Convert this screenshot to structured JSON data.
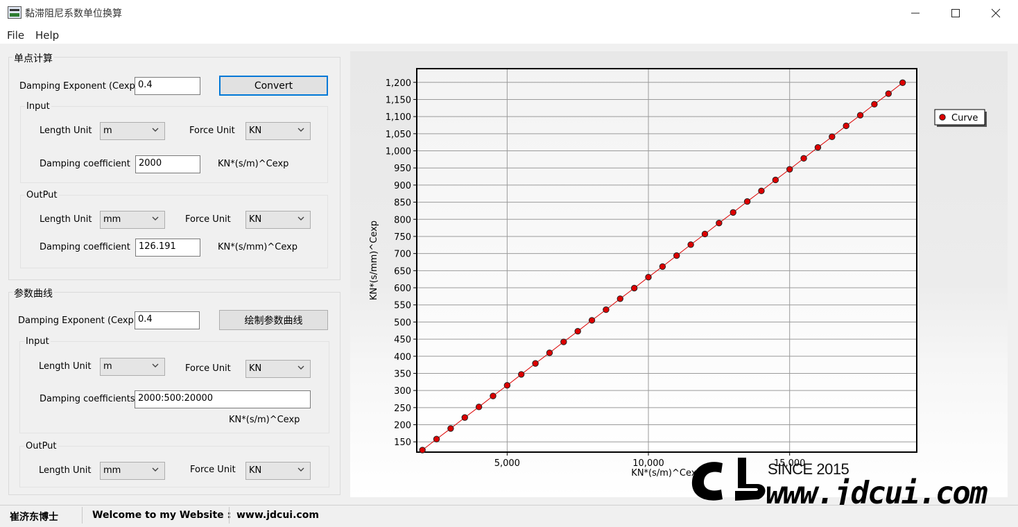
{
  "window": {
    "title": "黏滞阻尼系数单位换算"
  },
  "menu": [
    "File",
    "Help"
  ],
  "single_point": {
    "title": "单点计算",
    "exponent_label": "Damping Exponent (Cexp)",
    "exponent_value": "0.4",
    "convert_label": "Convert",
    "input": {
      "title": "Input",
      "length_label": "Length Unit",
      "length_value": "m",
      "force_label": "Force Unit",
      "force_value": "KN",
      "coef_label": "Damping coefficient",
      "coef_value": "2000",
      "unit_text": "KN*(s/m)^Cexp"
    },
    "output": {
      "title": "OutPut",
      "length_label": "Length Unit",
      "length_value": "mm",
      "force_label": "Force Unit",
      "force_value": "KN",
      "coef_label": "Damping coefficient",
      "coef_value": "126.191",
      "unit_text": "KN*(s/mm)^Cexp"
    }
  },
  "curve": {
    "title": "参数曲线",
    "exponent_label": "Damping Exponent  (Cexp)",
    "exponent_value": "0.4",
    "draw_label": "绘制参数曲线",
    "input": {
      "title": "Input",
      "length_label": "Length Unit",
      "length_value": "m",
      "force_label": "Force Unit",
      "force_value": "KN",
      "coef_label": "Damping coefficients",
      "coef_value": "2000:500:20000",
      "unit_text": "KN*(s/m)^Cexp"
    },
    "output": {
      "title": "OutPut",
      "length_label": "Length Unit",
      "length_value": "mm",
      "force_label": "Force Unit",
      "force_value": "KN"
    }
  },
  "chart_data": {
    "type": "line",
    "title": "",
    "xlabel": "KN*(s/m)^Cexp",
    "ylabel": "KN*(s/mm)^Cexp",
    "xlim": [
      1800,
      19500
    ],
    "ylim": [
      120,
      1240
    ],
    "x_ticks": [
      5000,
      10000,
      15000
    ],
    "x_tick_labels": [
      "5,000",
      "10,000",
      "15,000"
    ],
    "y_ticks": [
      150,
      200,
      250,
      300,
      350,
      400,
      450,
      500,
      550,
      600,
      650,
      700,
      750,
      800,
      850,
      900,
      950,
      1000,
      1050,
      1100,
      1150,
      1200
    ],
    "y_tick_labels": [
      "150",
      "200",
      "250",
      "300",
      "350",
      "400",
      "450",
      "500",
      "550",
      "600",
      "650",
      "700",
      "750",
      "800",
      "850",
      "900",
      "950",
      "1,000",
      "1,050",
      "1,100",
      "1,150",
      "1,200"
    ],
    "grid": true,
    "legend": "right",
    "series": [
      {
        "name": "Curve",
        "color": "#dd0000",
        "x": [
          2000,
          2500,
          3000,
          3500,
          4000,
          4500,
          5000,
          5500,
          6000,
          6500,
          7000,
          7500,
          8000,
          8500,
          9000,
          9500,
          10000,
          10500,
          11000,
          11500,
          12000,
          12500,
          13000,
          13500,
          14000,
          14500,
          15000,
          15500,
          16000,
          16500,
          17000,
          17500,
          18000,
          18500,
          19000
        ],
        "y": [
          126,
          158,
          189,
          221,
          252,
          284,
          315,
          347,
          379,
          410,
          442,
          473,
          505,
          536,
          568,
          599,
          631,
          662,
          694,
          726,
          757,
          789,
          820,
          852,
          883,
          915,
          946,
          978,
          1010,
          1041,
          1073,
          1104,
          1136,
          1167,
          1199
        ]
      }
    ]
  },
  "watermark": {
    "since": "SINCE 2015",
    "url": "www.jdcui.com"
  },
  "status": {
    "author": "崔济东博士",
    "welcome": "Welcome to my Website :",
    "site": "www.jdcui.com"
  }
}
